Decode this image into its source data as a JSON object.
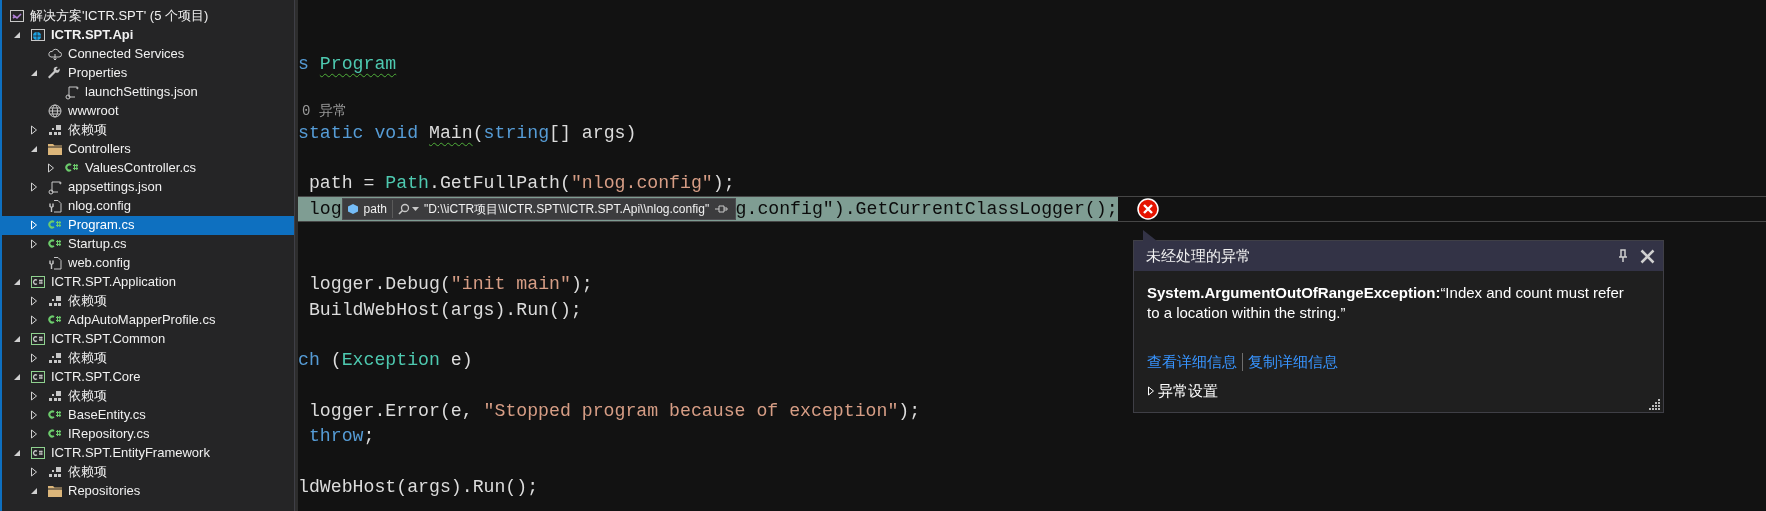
{
  "solution_explorer": {
    "items": [
      {
        "label": "解决方案'ICTR.SPT' (5 个项目)",
        "kind": "solution",
        "selected": false,
        "children": [
          {
            "label": "ICTR.SPT.Api",
            "kind": "web-project",
            "startup": true,
            "expanded": true,
            "selected": false,
            "children": [
              {
                "label": "Connected Services",
                "kind": "cloud",
                "selected": false
              },
              {
                "label": "Properties",
                "kind": "wrench",
                "expanded": true,
                "selected": false,
                "children": [
                  {
                    "label": "launchSettings.json",
                    "kind": "json",
                    "selected": false
                  }
                ]
              },
              {
                "label": "wwwroot",
                "kind": "globe",
                "selected": false
              },
              {
                "label": "依赖项",
                "kind": "deps",
                "expanded": false,
                "selected": false
              },
              {
                "label": "Controllers",
                "kind": "folder",
                "expanded": true,
                "selected": false,
                "children": [
                  {
                    "label": "ValuesController.cs",
                    "kind": "cs",
                    "expanded": false,
                    "selected": false
                  }
                ]
              },
              {
                "label": "appsettings.json",
                "kind": "json",
                "expanded": false,
                "selected": false
              },
              {
                "label": "nlog.config",
                "kind": "config",
                "selected": false
              },
              {
                "label": "Program.cs",
                "kind": "cs",
                "expanded": false,
                "selected": true
              },
              {
                "label": "Startup.cs",
                "kind": "cs",
                "expanded": false,
                "selected": false
              },
              {
                "label": "web.config",
                "kind": "config",
                "selected": false
              }
            ]
          },
          {
            "label": "ICTR.SPT.Application",
            "kind": "project",
            "startup": false,
            "expanded": true,
            "selected": false,
            "children": [
              {
                "label": "依赖项",
                "kind": "deps",
                "expanded": false,
                "selected": false
              },
              {
                "label": "AdpAutoMapperProfile.cs",
                "kind": "cs",
                "expanded": false,
                "selected": false
              }
            ]
          },
          {
            "label": "ICTR.SPT.Common",
            "kind": "project",
            "startup": false,
            "expanded": true,
            "selected": false,
            "children": [
              {
                "label": "依赖项",
                "kind": "deps",
                "expanded": false,
                "selected": false
              }
            ]
          },
          {
            "label": "ICTR.SPT.Core",
            "kind": "project",
            "startup": false,
            "expanded": true,
            "selected": false,
            "children": [
              {
                "label": "依赖项",
                "kind": "deps",
                "expanded": false,
                "selected": false
              },
              {
                "label": "BaseEntity.cs",
                "kind": "cs",
                "expanded": false,
                "selected": false
              },
              {
                "label": "IRepository.cs",
                "kind": "cs",
                "expanded": false,
                "selected": false
              }
            ]
          },
          {
            "label": "ICTR.SPT.EntityFramework",
            "kind": "project",
            "startup": false,
            "expanded": true,
            "selected": false,
            "children": [
              {
                "label": "依赖项",
                "kind": "deps",
                "expanded": false,
                "selected": false
              },
              {
                "label": "Repositories",
                "kind": "folder",
                "expanded": true,
                "selected": false
              }
            ]
          }
        ]
      }
    ]
  },
  "editor": {
    "lines": [
      {
        "kind": "code",
        "tokens": [
          {
            "text": "s ",
            "kind": "keyword"
          },
          {
            "text": "Program",
            "kind": "type",
            "squiggle": true
          }
        ]
      },
      {
        "kind": "blank"
      },
      {
        "kind": "codelens",
        "text": "0 异常"
      },
      {
        "kind": "code",
        "tokens": [
          {
            "text": "static void ",
            "kind": "keyword"
          },
          {
            "text": "Main",
            "kind": "plain",
            "squiggle": true
          },
          {
            "text": "(",
            "kind": "plain"
          },
          {
            "text": "string",
            "kind": "keyword"
          },
          {
            "text": "[] args)",
            "kind": "plain"
          }
        ]
      },
      {
        "kind": "blank"
      },
      {
        "kind": "code",
        "tokens": [
          {
            "text": " path = ",
            "kind": "plain"
          },
          {
            "text": "Path",
            "kind": "type"
          },
          {
            "text": ".GetFullPath(",
            "kind": "plain"
          },
          {
            "text": "\"nlog.config\"",
            "kind": "string"
          },
          {
            "text": ");",
            "kind": "plain"
          }
        ]
      },
      {
        "kind": "current",
        "before": "log",
        "after": "g.config\").GetCurrentClassLogger();",
        "datatip": {
          "name": "path",
          "value": "\"D:\\\\iCTR项目\\\\ICTR.SPT\\\\ICTR.SPT.Api\\\\nlog.config\""
        }
      },
      {
        "kind": "blank"
      },
      {
        "kind": "blank"
      },
      {
        "kind": "code",
        "tokens": [
          {
            "text": " logger.Debug(",
            "kind": "plain"
          },
          {
            "text": "\"init main\"",
            "kind": "string"
          },
          {
            "text": ");",
            "kind": "plain"
          }
        ]
      },
      {
        "kind": "code",
        "tokens": [
          {
            "text": " BuildWebHost(args).Run();",
            "kind": "plain"
          }
        ]
      },
      {
        "kind": "blank"
      },
      {
        "kind": "code",
        "tokens": [
          {
            "text": "ch",
            "kind": "keyword"
          },
          {
            "text": " (",
            "kind": "plain"
          },
          {
            "text": "Exception",
            "kind": "type"
          },
          {
            "text": " e)",
            "kind": "plain"
          }
        ]
      },
      {
        "kind": "blank"
      },
      {
        "kind": "code",
        "tokens": [
          {
            "text": " logger.Error(e, ",
            "kind": "plain"
          },
          {
            "text": "\"Stopped program because of exception\"",
            "kind": "string"
          },
          {
            "text": ");",
            "kind": "plain"
          }
        ]
      },
      {
        "kind": "code",
        "tokens": [
          {
            "text": " throw",
            "kind": "keyword"
          },
          {
            "text": ";",
            "kind": "plain"
          }
        ]
      },
      {
        "kind": "blank"
      },
      {
        "kind": "code",
        "tokens": [
          {
            "text": "ldWebHost(args).Run();",
            "kind": "plain"
          }
        ]
      }
    ]
  },
  "exception_popup": {
    "title": "未经处理的异常",
    "message": "**System.ArgumentOutOfRangeException:**“Index and count must refer to a location within the string.”",
    "links": [
      "查看详细信息",
      "复制详细信息"
    ],
    "settings": {
      "label": "异常设置",
      "expanded": false
    }
  }
}
